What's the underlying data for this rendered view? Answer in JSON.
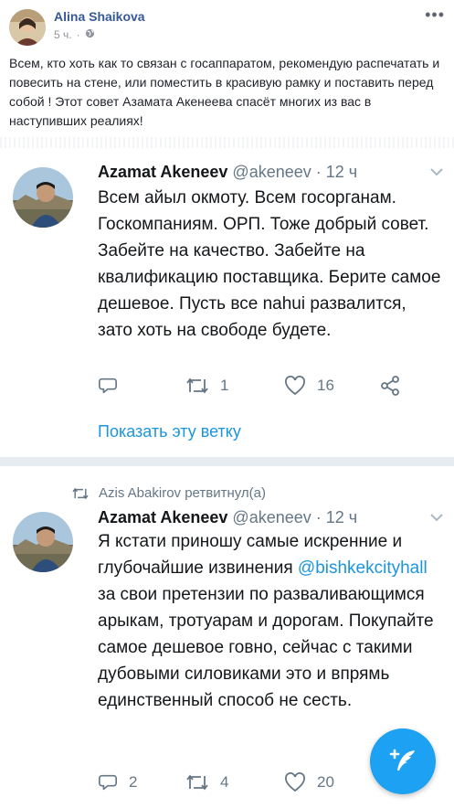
{
  "post": {
    "author": "Alina Shaikova",
    "time": "5 ч.",
    "text": "Всем, кто хоть как то связан с госаппаратом, рекомендую распечатать и повесить на стене, или поместить в красивую рамку и поставить перед собой ! Этот совет Азамата Акенеева спасёт многих из вас в наступивших реалиях!"
  },
  "tweets": [
    {
      "name": "Azamat Akeneev",
      "handle": "@akeneev",
      "sep": " · ",
      "time": "12 ч",
      "body": "Всем айыл окмоту. Всем госорганам. Госкомпаниям. ОРП. Тоже добрый совет. Забейте на качество. Забейте на квалификацию поставщика. Берите самое дешевое. Пусть все nahui развалится, зато хоть на свободе будете.",
      "replies": "",
      "retweets": "1",
      "likes": "16"
    },
    {
      "retweeted_by": "Azis Abakirov ретвитнул(а)",
      "name": "Azamat Akeneev",
      "handle": "@akeneev",
      "sep": " · ",
      "time": "12 ч",
      "body_before": "Я кстати приношу самые искренние и глубочайшие извинения",
      "mention": "@bishkekcityhall",
      "body_after": " за свои претензии по разваливающимся арыкам, тротуарам и дорогам. Покупайте самое дешевое говно, сейчас с такими дубовыми силовиками это  и впрямь единственный способ не сесть.",
      "replies": "2",
      "retweets": "4",
      "likes": "20"
    }
  ],
  "show_thread": "Показать эту ветку",
  "colors": {
    "fb_link": "#365899",
    "twitter_blue": "#1da1f2",
    "mention": "#1b95e0",
    "muted": "#657786"
  }
}
